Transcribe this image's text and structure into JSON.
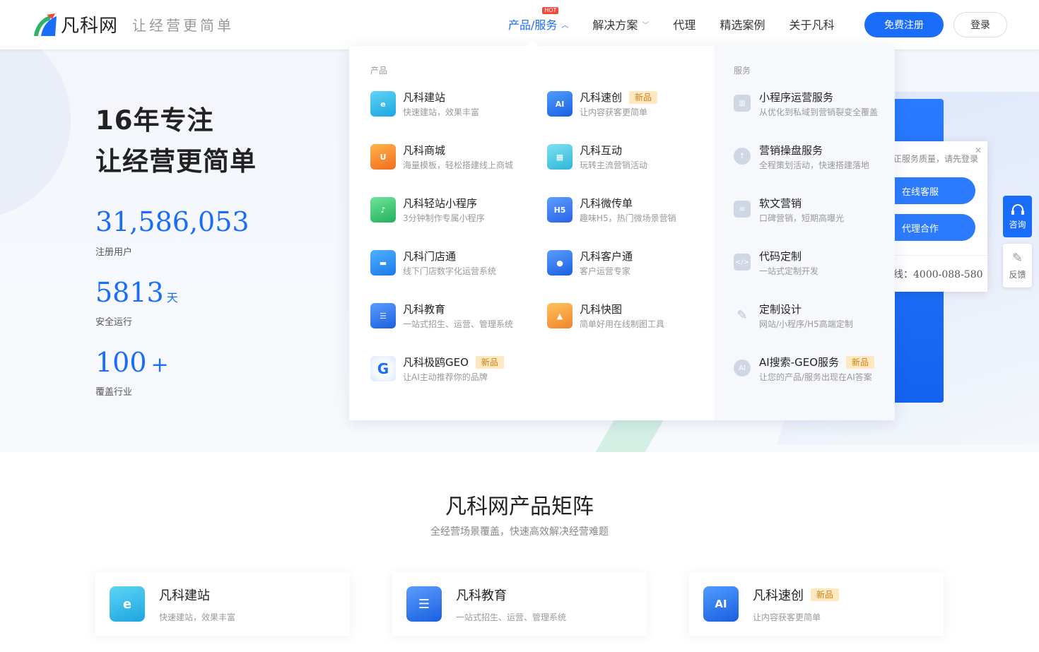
{
  "header": {
    "logo_name": "凡科网",
    "slogan": "让经营更简单",
    "nav": [
      {
        "label": "产品/服务",
        "badge": "HOT",
        "chevron": "up"
      },
      {
        "label": "解决方案",
        "chevron": "down"
      },
      {
        "label": "代理"
      },
      {
        "label": "精选案例"
      },
      {
        "label": "关于凡科"
      }
    ],
    "register_label": "免费注册",
    "login_label": "登录"
  },
  "hero": {
    "title_line1": "16年专注",
    "title_line2": "让经营更简单",
    "stats": [
      {
        "value": "31,586,053",
        "label": "注册用户"
      },
      {
        "value": "5813",
        "unit": "天",
        "label": "安全运行"
      },
      {
        "value": "100",
        "unit": "+",
        "label": "覆盖行业"
      }
    ]
  },
  "dropdown": {
    "products_heading": "产品",
    "services_heading": "服务",
    "products": [
      {
        "icon": "website-icon",
        "title": "凡科建站",
        "desc": "快速建站，效果丰富"
      },
      {
        "icon": "ai-icon",
        "title": "凡科速创",
        "desc": "让内容获客更简单",
        "badge": "新品"
      },
      {
        "icon": "shopping-bag-icon",
        "title": "凡科商城",
        "desc": "海量模板，轻松搭建线上商城"
      },
      {
        "icon": "gift-icon",
        "title": "凡科互动",
        "desc": "玩转主流营销活动"
      },
      {
        "icon": "mini-program-icon",
        "title": "凡科轻站小程序",
        "desc": "3分钟制作专属小程序"
      },
      {
        "icon": "h5-icon",
        "title": "凡科微传单",
        "desc": "趣味H5，热门微场景营销"
      },
      {
        "icon": "store-icon",
        "title": "凡科门店通",
        "desc": "线下门店数字化运营系统"
      },
      {
        "icon": "customer-icon",
        "title": "凡科客户通",
        "desc": "客户运营专家"
      },
      {
        "icon": "book-icon",
        "title": "凡科教育",
        "desc": "一站式招生、运营、管理系统"
      },
      {
        "icon": "image-icon",
        "title": "凡科快图",
        "desc": "简单好用在线制图工具"
      },
      {
        "icon": "geo-icon",
        "title": "凡科极鸥GEO",
        "desc": "让AI主动推荐你的品牌",
        "badge": "新品"
      }
    ],
    "services": [
      {
        "icon": "chart-icon",
        "title": "小程序运营服务",
        "desc": "从优化到私域到营销裂变全覆盖"
      },
      {
        "icon": "rocket-icon",
        "title": "营销操盘服务",
        "desc": "全程策划活动，快速搭建落地"
      },
      {
        "icon": "article-icon",
        "title": "软文营销",
        "desc": "口碑营销，短期高曝光"
      },
      {
        "icon": "code-icon",
        "title": "代码定制",
        "desc": "一站式定制开发"
      },
      {
        "icon": "design-icon",
        "title": "定制设计",
        "desc": "网站/小程序/H5高端定制"
      },
      {
        "icon": "ai-search-icon",
        "title": "AI搜索-GEO服务",
        "desc": "让您的产品/服务出现在AI答案",
        "badge": "新品"
      }
    ]
  },
  "popup": {
    "text": "正服务质量，请先登录",
    "online_service": "在线客服",
    "agent_coop": "代理合作",
    "phone": "线：4000-088-580"
  },
  "side_tools": {
    "consult": "咨询",
    "feedback": "反馈"
  },
  "matrix": {
    "title": "凡科网产品矩阵",
    "subtitle": "全经营场景覆盖，快速高效解决经营难题",
    "cards": [
      {
        "icon": "website-icon",
        "title": "凡科建站",
        "desc": "快速建站，效果丰富"
      },
      {
        "icon": "book-icon",
        "title": "凡科教育",
        "desc": "一站式招生、运营、管理系统"
      },
      {
        "icon": "ai-icon",
        "title": "凡科速创",
        "desc": "让内容获客更简单",
        "badge": "新品"
      }
    ]
  },
  "colors": {
    "brand_blue": "#1a6dfb",
    "badge_bg": "#ffe7bf",
    "badge_text": "#c9851b",
    "hot_red": "#f04a3c"
  }
}
